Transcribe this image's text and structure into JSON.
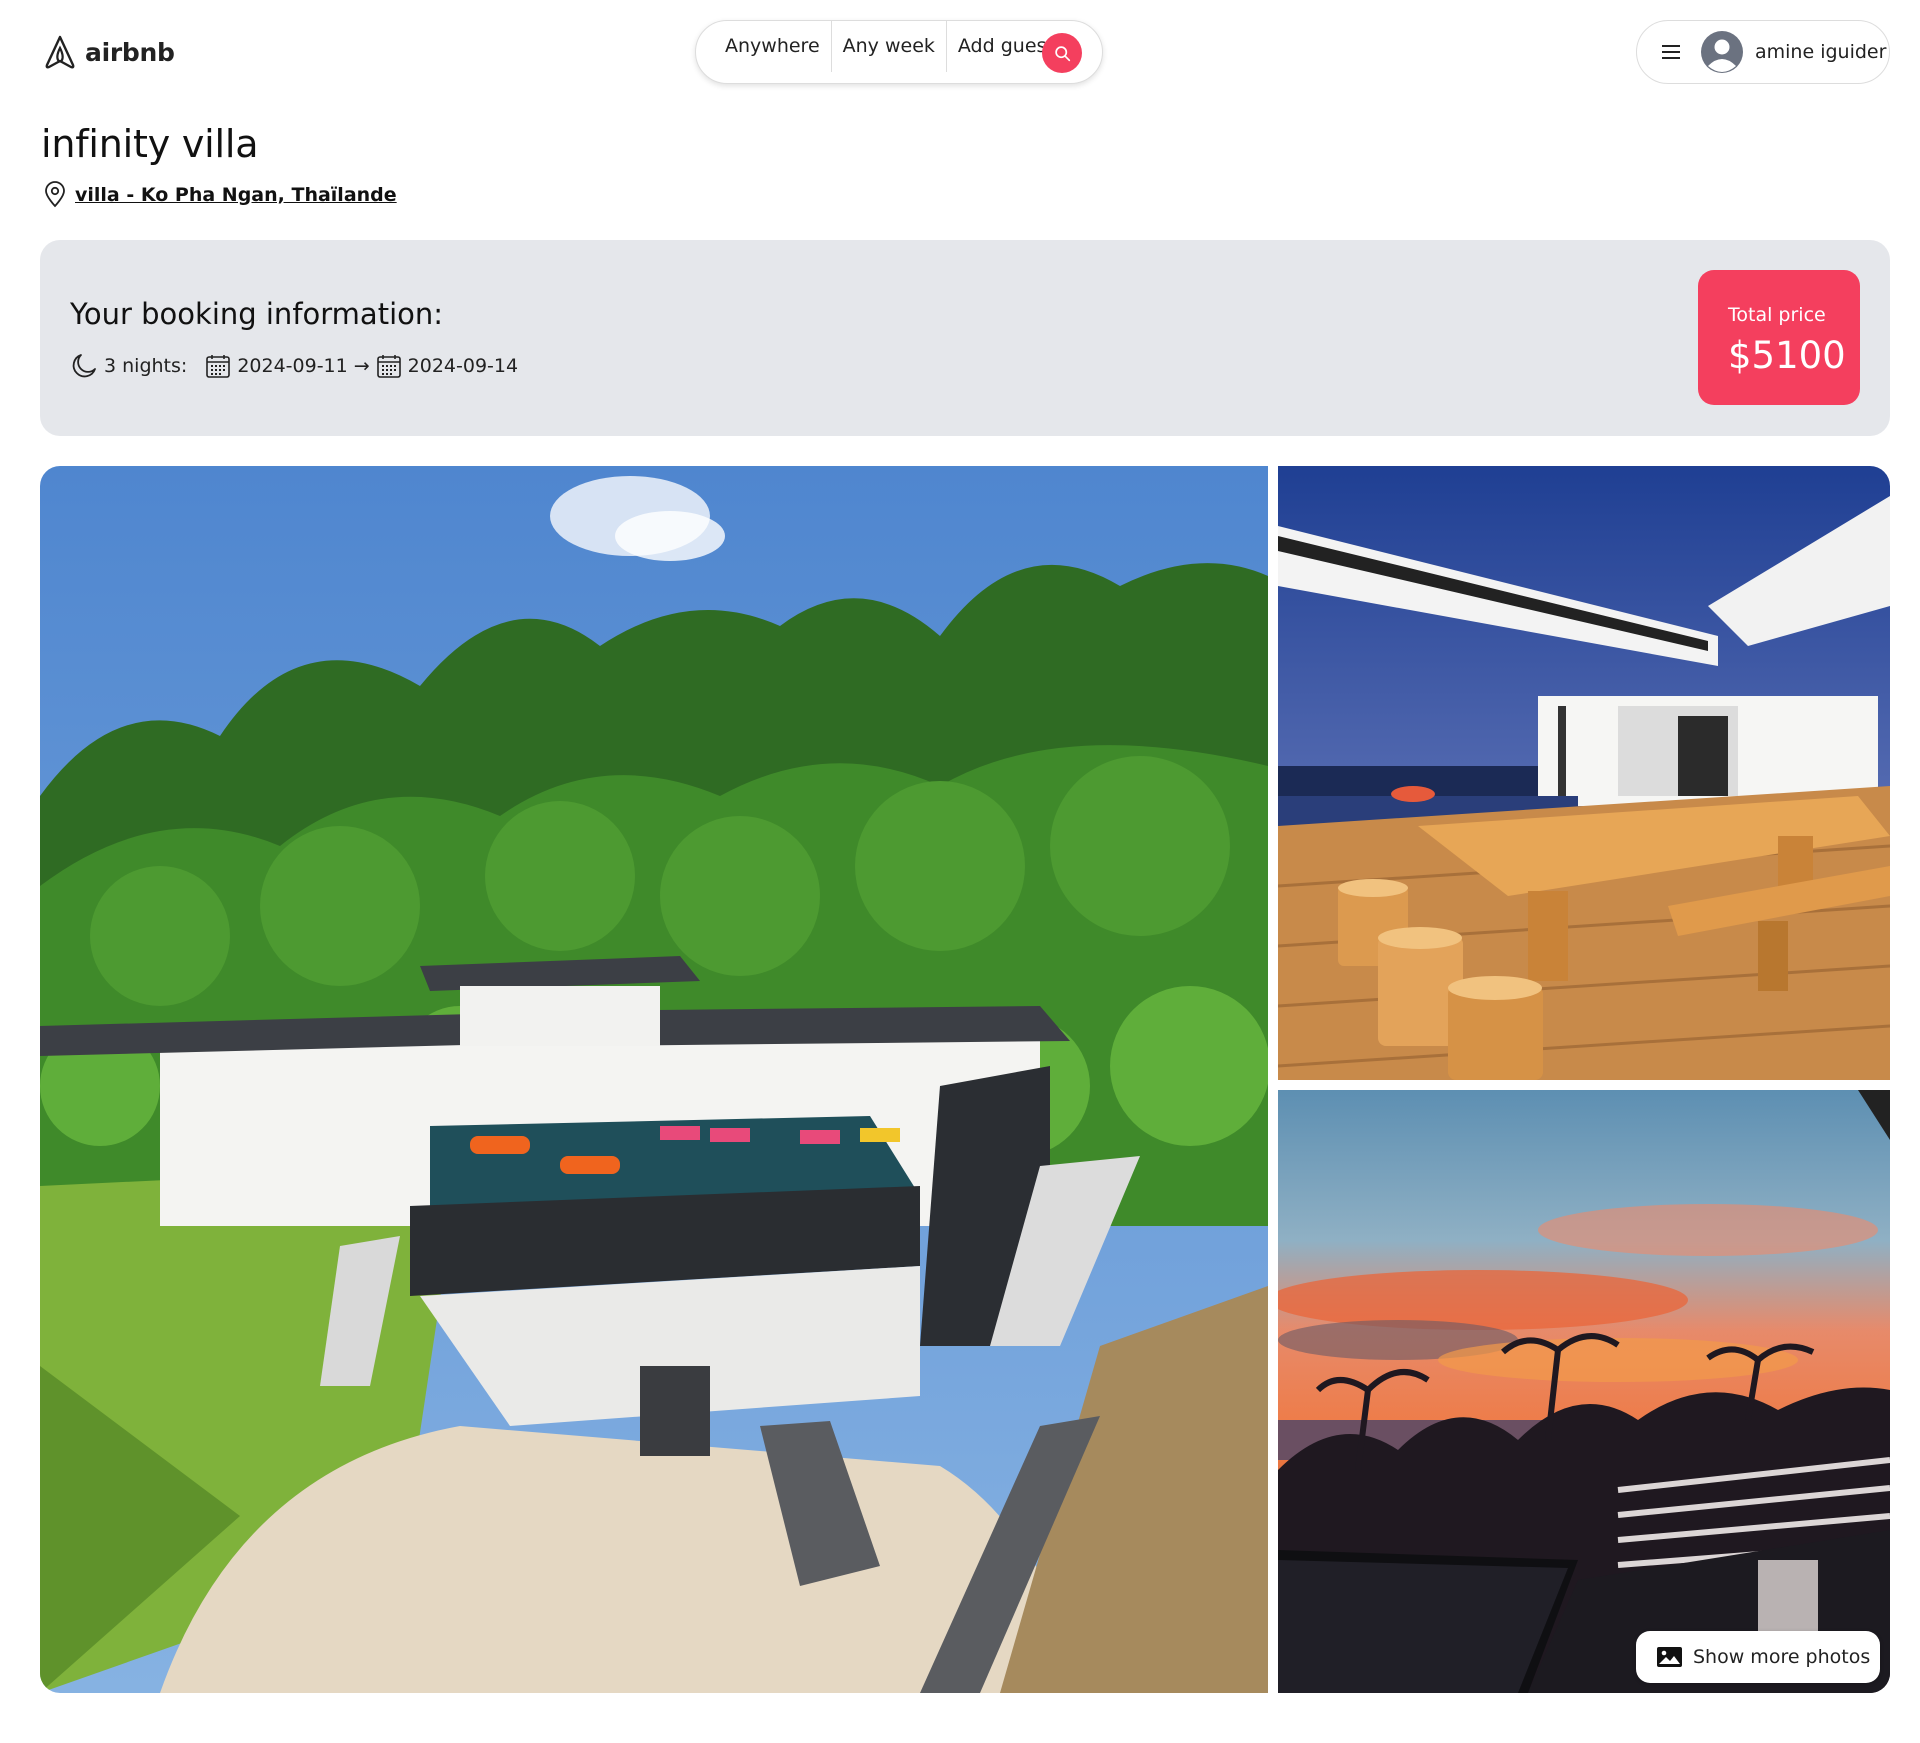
{
  "brand": {
    "name": "airbnb",
    "color": "#f43f5e"
  },
  "search": {
    "where": "Anywhere",
    "when": "Any week",
    "who": "Add guests",
    "button_icon": "search-icon"
  },
  "user": {
    "menu_icon": "menu-icon",
    "avatar_icon": "user-avatar-icon",
    "name": "amine iguider"
  },
  "listing": {
    "title": "infinity villa",
    "location": "villa - Ko Pha Ngan, Thaïlande"
  },
  "booking": {
    "heading": "Your booking information:",
    "nights_label": "3 nights:",
    "start_date": "2024-09-11",
    "arrow": "→",
    "end_date": "2024-09-14",
    "total_label": "Total price",
    "total_value": "$5100"
  },
  "gallery": {
    "images": [
      {
        "name": "villa aerial view",
        "kind": "photo"
      },
      {
        "name": "outdoor wooden dining terrace",
        "kind": "photo"
      },
      {
        "name": "sunset view from balcony",
        "kind": "photo"
      }
    ],
    "show_more_label": "Show more photos",
    "show_more_icon": "image-icon"
  }
}
